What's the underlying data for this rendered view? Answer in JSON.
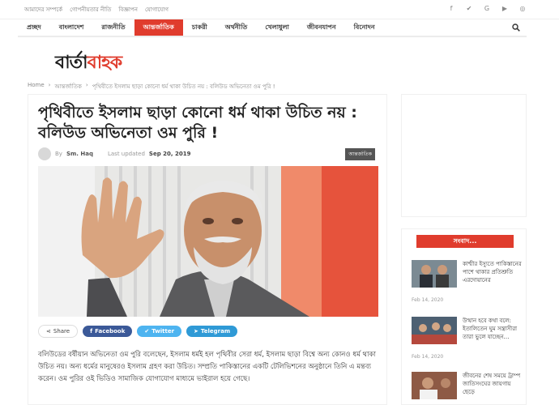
{
  "topbar": {
    "links": [
      "আমাদের সম্পর্কে",
      "গোপনীয়তার নীতি",
      "বিজ্ঞাপন",
      "যোগাযোগ"
    ],
    "social_icons": [
      "facebook-icon",
      "twitter-icon",
      "google-plus-icon",
      "youtube-icon",
      "instagram-icon"
    ]
  },
  "nav": {
    "items": [
      "প্রচ্ছদ",
      "বাংলাদেশ",
      "রাজনীতি",
      "আন্তর্জাতিক",
      "চাকরী",
      "অর্থনীতি",
      "খেলাধুলা",
      "জীবনযাপন",
      "বিনোদন"
    ],
    "active_index": 3
  },
  "logo": {
    "part1": "বার্তা",
    "part2": "বাহক"
  },
  "breadcrumb": [
    "Home",
    "›",
    "আন্তর্জাতিক",
    "›",
    "পৃথিবীতে ইসলাম ছাড়া কোনো ধর্ম থাকা উচিত নয় : বলিউড অভিনেতা ওম পুরি !"
  ],
  "article": {
    "title": "পৃথিবীতে ইসলাম ছাড়া কোনো ধর্ম থাকা উচিত নয় : বলিউড অভিনেতা ওম পুরি !",
    "by": "By",
    "author": "Sm. Haq",
    "last_updated_label": "Last updated",
    "date": "Sep 20, 2019",
    "category": "আন্তর্জাতিক",
    "body": "বলিউডের বর্ষীয়ান অভিনেতা ওম পুরি বলেছেন, ইসলাম ধর্মই হল পৃথিবীর সেরা ধর্ম, ইসলাম ছাড়া বিশ্বে অন্য কোনও ধর্ম থাকা উচিত নয়। অন্য ধর্মের মানুষেরও ইসলাম গ্রহণ করা উচিত। সম্প্রতি পাকিস্তানের একটি টেলিভিশনের অনুষ্ঠানে তিনি এ মন্তব্য করেন। ওম পুরির ওই ভিডিও সামাজিক যোগাযোগ মাধ্যমে ভাইরাল হয়ে গেছে।"
  },
  "share": {
    "share_label": "Share",
    "facebook_label": "Facebook",
    "twitter_label": "Twitter",
    "telegram_label": "Telegram"
  },
  "sidebar": {
    "news_heading": "সংবাদ...",
    "items": [
      {
        "title": "কাশ্মীর ইস্যুতে পাকিস্তানের পাশে থাকার প্রতিশ্রুতি এরদোয়ানের",
        "date": "Feb 14, 2020"
      },
      {
        "title": "উত্থান হবে কথা বলে: ইতালিতেন ঘুম সন্ত্রাসীরা তারা ভুলে যাচ্ছেন…",
        "date": "Feb 14, 2020"
      },
      {
        "title": "জীবনের শেষ সময়ে ট্রাম্প জাতিসংঘের জায়গায় ছেড়ে",
        "date": ""
      }
    ]
  },
  "colors": {
    "accent": "#e03c2d",
    "facebook": "#3b5998",
    "twitter": "#4eb4f0",
    "telegram": "#2f9ad6"
  }
}
